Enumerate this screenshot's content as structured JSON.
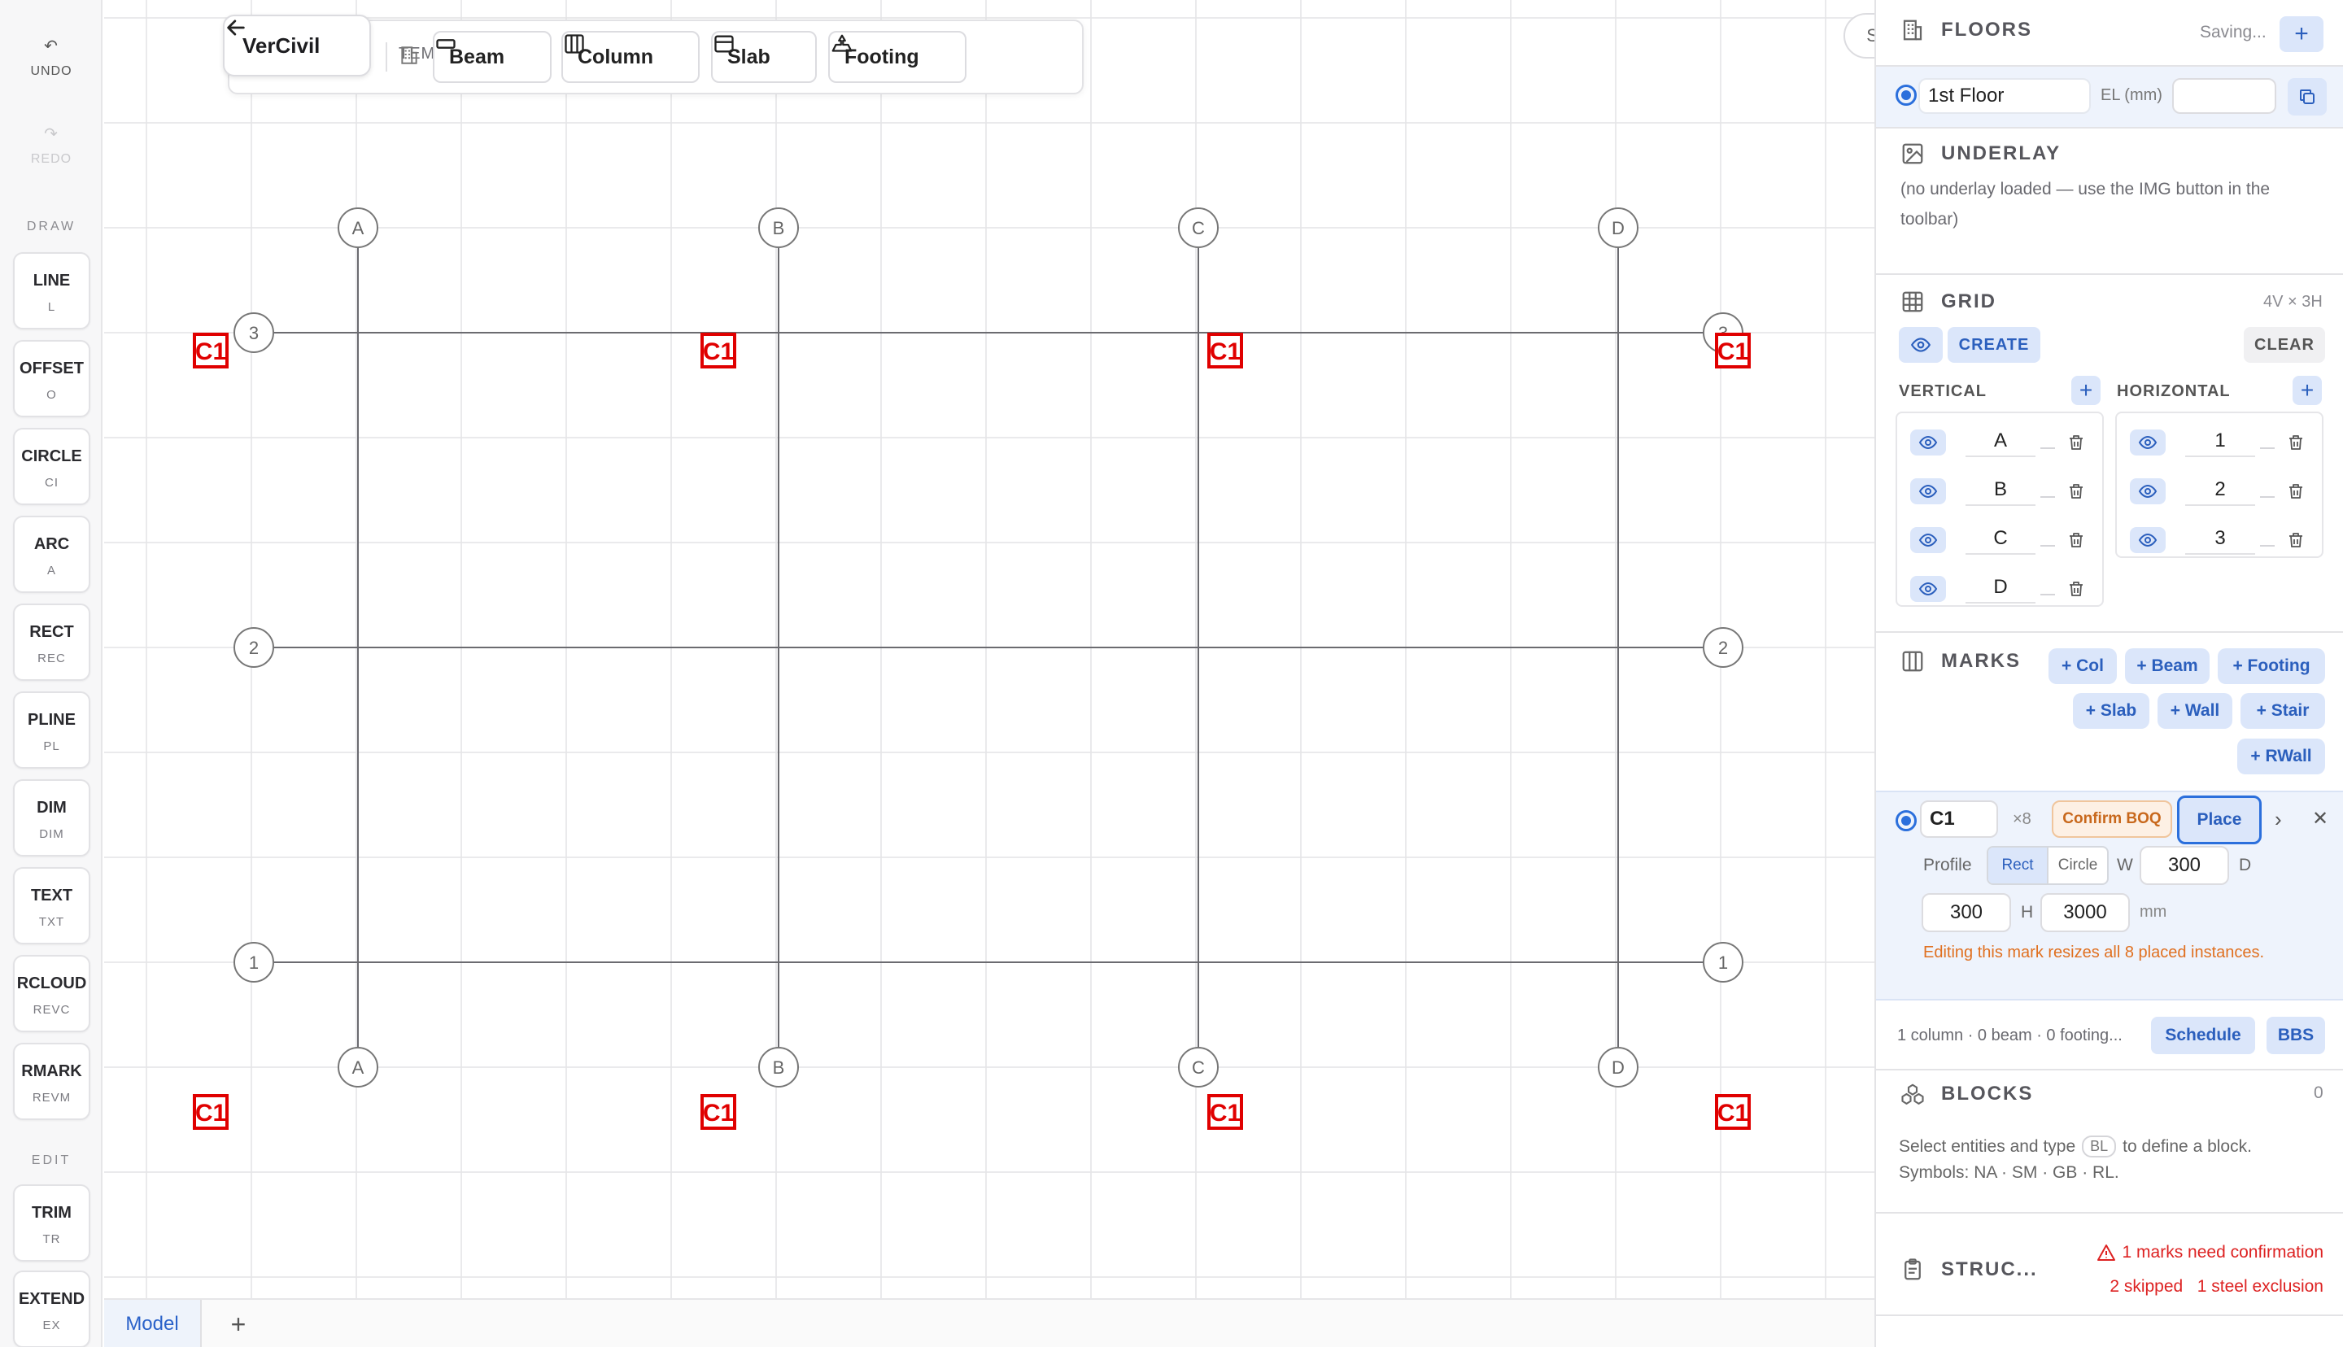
{
  "rail": {
    "undo": {
      "glyph": "↶",
      "label": "UNDO"
    },
    "redo": {
      "glyph": "↷",
      "label": "REDO"
    },
    "draw_label": "DRAW",
    "tools": [
      {
        "name": "LINE",
        "key": "L"
      },
      {
        "name": "OFFSET",
        "key": "O"
      },
      {
        "name": "CIRCLE",
        "key": "CI"
      },
      {
        "name": "ARC",
        "key": "A"
      },
      {
        "name": "RECT",
        "key": "REC"
      },
      {
        "name": "PLINE",
        "key": "PL"
      },
      {
        "name": "DIM",
        "key": "DIM"
      },
      {
        "name": "TEXT",
        "key": "TXT"
      },
      {
        "name": "RCLOUD",
        "key": "REVC"
      },
      {
        "name": "RMARK",
        "key": "REVM"
      }
    ],
    "edit_label": "EDIT",
    "edit_tools": [
      {
        "name": "TRIM",
        "key": "TR"
      },
      {
        "name": "EXTEND",
        "key": "EX"
      }
    ]
  },
  "toolbar": {
    "back_label": "VerCivil",
    "templates_label": "TEMPLATES",
    "templates": [
      {
        "label": "Beam",
        "icon": "beam-icon"
      },
      {
        "label": "Column",
        "icon": "column-icon"
      },
      {
        "label": "Slab",
        "icon": "slab-icon"
      },
      {
        "label": "Footing",
        "icon": "footing-icon"
      }
    ]
  },
  "canvas": {
    "saving": "Saving...",
    "vertical_bubbles": [
      "A",
      "B",
      "C",
      "D"
    ],
    "horizontal_bubbles": [
      "3",
      "2",
      "1"
    ],
    "column_tag": "C1",
    "help": "?"
  },
  "tabs": {
    "model": "Model",
    "add": "+"
  },
  "panel": {
    "floors": {
      "title": "FLOORS",
      "status": "Saving...",
      "add": "+",
      "floor_name": "1st Floor",
      "el_label": "EL (mm)",
      "el_value": ""
    },
    "underlay": {
      "title": "UNDERLAY",
      "message": "(no underlay loaded — use the IMG button in the toolbar)"
    },
    "grid": {
      "title": "GRID",
      "summary": "4V × 3H",
      "create": "CREATE",
      "clear": "CLEAR",
      "vertical_label": "VERTICAL",
      "horizontal_label": "HORIZONTAL",
      "vertical": [
        "A",
        "B",
        "C",
        "D"
      ],
      "horizontal": [
        "1",
        "2",
        "3"
      ]
    },
    "marks": {
      "title": "MARKS",
      "buttons": [
        "+ Col",
        "+ Beam",
        "+ Footing",
        "+ Slab",
        "+ Wall",
        "+ Stair",
        "+ RWall"
      ]
    },
    "mark_editor": {
      "name": "C1",
      "count": "×8",
      "confirm": "Confirm BOQ",
      "place": "Place",
      "profile_label": "Profile",
      "profile_rect": "Rect",
      "profile_circle": "Circle",
      "w_label": "W",
      "w_value": "300",
      "d_label": "D",
      "d_value": "300",
      "h_label": "H",
      "h_value": "3000",
      "unit": "mm",
      "warning": "Editing this mark resizes all 8 placed instances."
    },
    "summary": {
      "text": "1 column · 0 beam · 0 footing...",
      "schedule": "Schedule",
      "bbs": "BBS"
    },
    "blocks": {
      "title": "BLOCKS",
      "count": "0",
      "line1_a": "Select entities and type",
      "line1_key": "BL",
      "line1_b": "to define a block.",
      "line2": "Symbols: NA · SM · GB · RL."
    },
    "struc": {
      "title": "STRUC...",
      "warn1": "1 marks need confirmation",
      "warn2a": "2 skipped",
      "warn2b": "1 steel exclusion"
    }
  },
  "colors": {
    "accent": "#2b6fdc",
    "column_tag": "#e00000",
    "warning_orange": "#e07020",
    "error_red": "#d22222"
  }
}
